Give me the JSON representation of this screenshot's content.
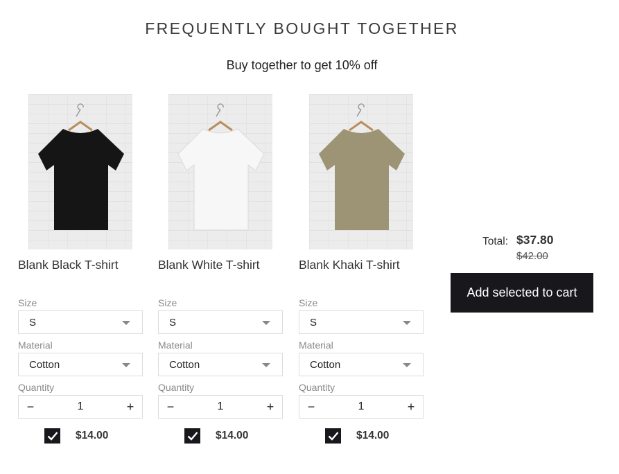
{
  "header": {
    "title": "FREQUENTLY BOUGHT TOGETHER",
    "subtitle": "Buy together to get 10% off"
  },
  "labels": {
    "size": "Size",
    "material": "Material",
    "quantity": "Quantity",
    "minus": "−",
    "plus": "+"
  },
  "products": [
    {
      "name": "Blank Black T-shirt",
      "size": "S",
      "material": "Cotton",
      "quantity": "1",
      "price": "$14.00",
      "checked": true,
      "shirt_color": "#151515",
      "image_icon": "black-tshirt-photo"
    },
    {
      "name": "Blank White T-shirt",
      "size": "S",
      "material": "Cotton",
      "quantity": "1",
      "price": "$14.00",
      "checked": true,
      "shirt_color": "#f7f7f7",
      "image_icon": "white-tshirt-photo"
    },
    {
      "name": "Blank Khaki T-shirt",
      "size": "S",
      "material": "Cotton",
      "quantity": "1",
      "price": "$14.00",
      "checked": true,
      "shirt_color": "#9c9474",
      "image_icon": "khaki-tshirt-photo"
    }
  ],
  "summary": {
    "total_label": "Total:",
    "total_price": "$37.80",
    "original_price": "$42.00",
    "cta_label": "Add selected to cart"
  },
  "colors": {
    "accent": "#17171c",
    "text": "#333333",
    "muted": "#8a8a8a",
    "border": "#dcdcdc"
  }
}
